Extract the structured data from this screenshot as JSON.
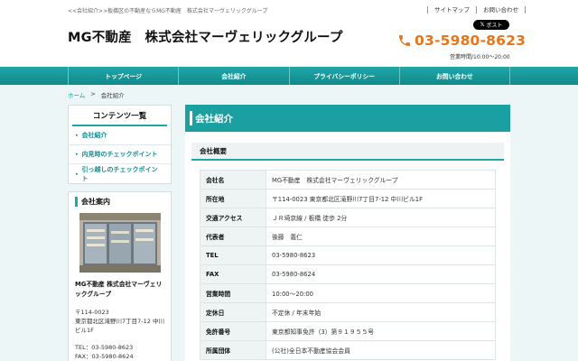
{
  "header": {
    "tagline": "<<会社紹介>>板橋区の不動産ならMG不動産　株式会社マーヴェリックグループ",
    "links": [
      "サイトマップ",
      "お問い合わせ"
    ],
    "logo": "MG不動産　株式会社マーヴェリックグループ",
    "post_button": "ポスト",
    "phone": "03-5980-8623",
    "hours": "営業時間/10:00～20:00",
    "accent_color": "#e8751a"
  },
  "nav": {
    "items": [
      "トップページ",
      "会社紹介",
      "プライバシーポリシー",
      "お問い合わせ"
    ],
    "color": "#1aa0a1"
  },
  "breadcrumb": {
    "home": "ホーム",
    "separator": ">",
    "current": "会社紹介"
  },
  "sidebar": {
    "contents_title": "コンテンツ一覧",
    "menu": [
      "会社紹介",
      "内見時のチェックポイント",
      "引っ越しのチェックポイント"
    ],
    "company_title": "会社案内",
    "company_name": "MG不動産 株式会社マーヴェリックグループ",
    "postal": "〒114-0023",
    "address": "東京都北区滝野川7丁目7-12 中川ビル1F",
    "tel": "TEL：03-5980-8623",
    "fax": "FAX：03-5980-8624"
  },
  "main": {
    "title": "会社紹介",
    "section": "会社概要",
    "rows": [
      {
        "k": "会社名",
        "v": "MG不動産　株式会社マーヴェリックグループ"
      },
      {
        "k": "所在地",
        "v": "〒114-0023 東京都北区滝野川7丁目7-12 中川ビル1F"
      },
      {
        "k": "交通アクセス",
        "v": "ＪＲ埼京線 / 板橋 徒歩 2分"
      },
      {
        "k": "代表者",
        "v": "後藤　義仁"
      },
      {
        "k": "TEL",
        "v": "03-5980-8623"
      },
      {
        "k": "FAX",
        "v": "03-5980-8624"
      },
      {
        "k": "営業時間",
        "v": "10:00～20:00"
      },
      {
        "k": "定休日",
        "v": "不定休 / 年末年始"
      },
      {
        "k": "免許番号",
        "v": "東京都知事免許（3）第９１９５５号"
      },
      {
        "k": "所属団体",
        "v": "(公社)全日本不動産協会会員"
      }
    ]
  }
}
